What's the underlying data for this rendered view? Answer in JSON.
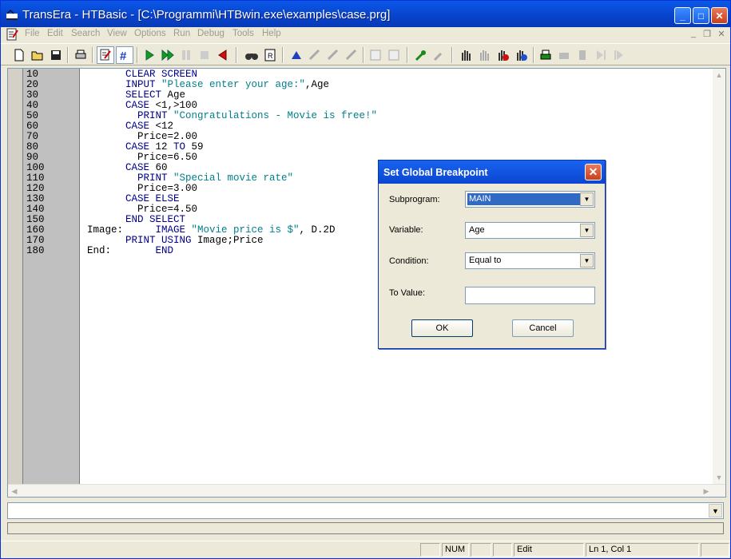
{
  "window": {
    "title": "TransEra - HTBasic - [C:\\Programmi\\HTBwin.exe\\examples\\case.prg]",
    "buttons": [
      "minimize",
      "maximize",
      "close"
    ]
  },
  "menu": [
    "File",
    "Edit",
    "Search",
    "View",
    "Options",
    "Run",
    "Debug",
    "Tools",
    "Help"
  ],
  "toolbar": {
    "icons": [
      "new-file-icon",
      "open-folder-icon",
      "save-icon",
      "print-icon",
      "edit-mode-icon",
      "line-numbers-icon",
      "run-icon",
      "continue-icon",
      "pause-icon",
      "stop-icon",
      "reset-icon",
      "find-icon",
      "replace-icon",
      "step-icon",
      "step-over-icon",
      "step-out-icon",
      "step-into-icon",
      "watch-icon",
      "breakpoint-icon",
      "wrench-icon",
      "settings-icon",
      "hand-icon",
      "hand-disabled-icon",
      "breakpoint-hand-icon",
      "global-breakpoint-icon",
      "printer-setup-icon",
      "device-icon",
      "label-icon",
      "next-icon",
      "last-icon"
    ]
  },
  "code": [
    {
      "n": "10",
      "label": "",
      "parts": [
        [
          "kw",
          "CLEAR SCREEN"
        ]
      ]
    },
    {
      "n": "20",
      "label": "",
      "parts": [
        [
          "kw",
          "INPUT "
        ],
        [
          "str",
          "\"Please enter your age:\""
        ],
        [
          "pl",
          ",Age"
        ]
      ]
    },
    {
      "n": "30",
      "label": "",
      "parts": [
        [
          "kw",
          "SELECT "
        ],
        [
          "pl",
          "Age"
        ]
      ]
    },
    {
      "n": "40",
      "label": "",
      "parts": [
        [
          "kw",
          "CASE "
        ],
        [
          "pl",
          "<1,>100"
        ]
      ]
    },
    {
      "n": "50",
      "label": "",
      "parts": [
        [
          "kw",
          "  PRINT "
        ],
        [
          "str",
          "\"Congratulations - Movie is free!\""
        ]
      ]
    },
    {
      "n": "60",
      "label": "",
      "parts": [
        [
          "kw",
          "CASE "
        ],
        [
          "pl",
          "<12"
        ]
      ]
    },
    {
      "n": "70",
      "label": "",
      "parts": [
        [
          "pl",
          "  Price=2.00"
        ]
      ]
    },
    {
      "n": "80",
      "label": "",
      "parts": [
        [
          "kw",
          "CASE "
        ],
        [
          "pl",
          "12 "
        ],
        [
          "kw",
          "TO "
        ],
        [
          "pl",
          "59"
        ]
      ]
    },
    {
      "n": "90",
      "label": "",
      "parts": [
        [
          "pl",
          "  Price=6.50"
        ]
      ]
    },
    {
      "n": "100",
      "label": "",
      "parts": [
        [
          "kw",
          "CASE "
        ],
        [
          "pl",
          "60"
        ]
      ]
    },
    {
      "n": "110",
      "label": "",
      "parts": [
        [
          "kw",
          "  PRINT "
        ],
        [
          "str",
          "\"Special movie rate\""
        ]
      ]
    },
    {
      "n": "120",
      "label": "",
      "parts": [
        [
          "pl",
          "  Price=3.00"
        ]
      ]
    },
    {
      "n": "130",
      "label": "",
      "parts": [
        [
          "kw",
          "CASE ELSE"
        ]
      ]
    },
    {
      "n": "140",
      "label": "",
      "parts": [
        [
          "pl",
          "  Price=4.50"
        ]
      ]
    },
    {
      "n": "150",
      "label": "",
      "parts": [
        [
          "kw",
          "END SELECT"
        ]
      ]
    },
    {
      "n": "160",
      "label": "Image:",
      "parts": [
        [
          "kw",
          "     IMAGE "
        ],
        [
          "str",
          "\"Movie price is $\""
        ],
        [
          "pl",
          ", D.2D"
        ]
      ]
    },
    {
      "n": "170",
      "label": "",
      "parts": [
        [
          "kw",
          "PRINT USING "
        ],
        [
          "pl",
          "Image;Price"
        ]
      ]
    },
    {
      "n": "180",
      "label": "End:",
      "parts": [
        [
          "kw",
          "     END"
        ]
      ]
    }
  ],
  "command_line": {
    "value": ""
  },
  "status": {
    "num": "NUM",
    "mode": "Edit",
    "position": "Ln 1, Col 1"
  },
  "dialog": {
    "title": "Set Global Breakpoint",
    "subprogram_label": "Subprogram:",
    "subprogram_value": "MAIN",
    "variable_label": "Variable:",
    "variable_value": "Age",
    "condition_label": "Condition:",
    "condition_value": "Equal to",
    "to_value_label": "To Value:",
    "to_value": "",
    "ok_label": "OK",
    "cancel_label": "Cancel"
  },
  "colors": {
    "keyword": "#00008b",
    "string": "#00808b",
    "titlebar": "#0a58e8",
    "selection": "#316ac5"
  }
}
